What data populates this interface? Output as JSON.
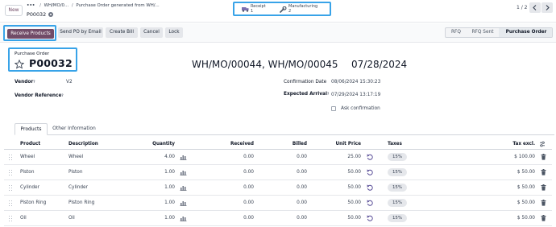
{
  "breadcrumbs": {
    "dots": "•••",
    "level1": "WH/MO/0...",
    "level2": "Purchase Order generated from WH/..."
  },
  "header": {
    "new_label": "New",
    "record_title": "P00032"
  },
  "smart_buttons": [
    {
      "label": "Receipt",
      "count": "1",
      "icon": "truck-icon"
    },
    {
      "label": "Manufacturing",
      "count": "2",
      "icon": "wrench-icon"
    }
  ],
  "pager": {
    "text": "1 / 2"
  },
  "actions": {
    "receive": "Receive Products",
    "send_po": "Send PO by Email",
    "create_bill": "Create Bill",
    "cancel": "Cancel",
    "lock": "Lock"
  },
  "status_stages": [
    {
      "label": "RFQ",
      "active": false
    },
    {
      "label": "RFQ Sent",
      "active": false
    },
    {
      "label": "Purchase Order",
      "active": true
    }
  ],
  "form": {
    "type_label": "Purchase Order",
    "name": "P00032",
    "origin": "WH/MO/00044, WH/MO/00045",
    "big_date": "07/28/2024",
    "vendor_label": "Vendor",
    "vendor_value": "V2",
    "vendor_ref_label": "Vendor Reference",
    "confirmation_label": "Confirmation Date",
    "confirmation_value": "08/06/2024 15:30:23",
    "expected_label": "Expected Arrival",
    "expected_value": "07/29/2024 13:17:19",
    "ask_confirmation": "Ask confirmation",
    "help_mark": "?"
  },
  "tabs": [
    {
      "label": "Products",
      "active": true
    },
    {
      "label": "Other Information",
      "active": false
    }
  ],
  "table": {
    "columns": {
      "product": "Product",
      "description": "Description",
      "quantity": "Quantity",
      "received": "Received",
      "billed": "Billed",
      "unit_price": "Unit Price",
      "taxes": "Taxes",
      "tax_excl": "Tax excl."
    },
    "rows": [
      {
        "product": "Wheel",
        "description": "Wheel",
        "quantity": "4.00",
        "received": "0.00",
        "billed": "0.00",
        "unit_price": "25.00",
        "taxes": "15%",
        "subtotal": "$ 100.00"
      },
      {
        "product": "Piston",
        "description": "Piston",
        "quantity": "1.00",
        "received": "0.00",
        "billed": "0.00",
        "unit_price": "50.00",
        "taxes": "15%",
        "subtotal": "$ 50.00"
      },
      {
        "product": "Cylinder",
        "description": "Cylinder",
        "quantity": "1.00",
        "received": "0.00",
        "billed": "0.00",
        "unit_price": "50.00",
        "taxes": "15%",
        "subtotal": "$ 50.00"
      },
      {
        "product": "Piston Ring",
        "description": "Piston Ring",
        "quantity": "1.00",
        "received": "0.00",
        "billed": "0.00",
        "unit_price": "50.00",
        "taxes": "15%",
        "subtotal": "$ 50.00"
      },
      {
        "product": "Oil",
        "description": "Oil",
        "quantity": "1.00",
        "received": "0.00",
        "billed": "0.00",
        "unit_price": "50.00",
        "taxes": "15%",
        "subtotal": "$ 50.00"
      }
    ]
  },
  "colors": {
    "primary": "#714B67",
    "highlight": "#38a3e8",
    "icon": "#6b7280"
  }
}
